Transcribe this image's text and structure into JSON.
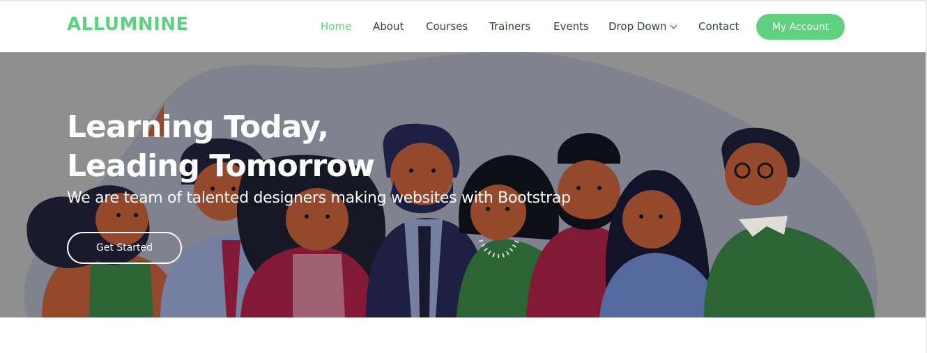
{
  "brand": {
    "name": "ALLUMNINE",
    "color": "#5fcf80"
  },
  "nav": {
    "items": [
      {
        "label": "Home",
        "active": true
      },
      {
        "label": "About"
      },
      {
        "label": "Courses"
      },
      {
        "label": "Trainers"
      },
      {
        "label": "Events"
      },
      {
        "label": "Drop Down",
        "icon": "chevron-down-icon"
      },
      {
        "label": "Contact"
      }
    ],
    "account_label": "My Account"
  },
  "hero": {
    "title_line1": "Learning Today,",
    "title_line2": "Leading Tomorrow",
    "subtitle": "We are team of talented designers making websites with Bootstrap",
    "cta_label": "Get Started",
    "illustration": "group-of-people-illustration"
  },
  "colors": {
    "accent": "#5fcf80",
    "text": "#37423b",
    "hero_overlay": "#959595"
  }
}
